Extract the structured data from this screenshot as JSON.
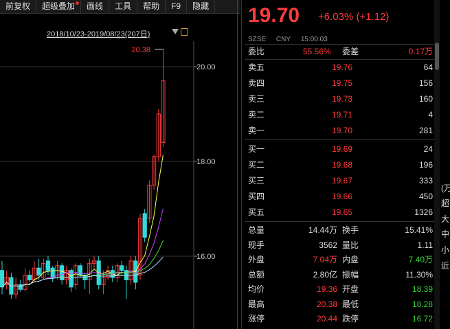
{
  "toolbar": {
    "items": [
      "前复权",
      "超级叠加",
      "画线",
      "工具",
      "帮助",
      "F9",
      "隐藏"
    ]
  },
  "chart": {
    "range": "2018/10/23-2019/08/23(207日)",
    "y_ticks": [
      "20.00",
      "18.00",
      "16.00"
    ],
    "high_marker": "20.38",
    "candles": [
      {
        "o": 15.7,
        "c": 15.35,
        "h": 15.9,
        "l": 15.2
      },
      {
        "o": 15.4,
        "c": 15.55,
        "h": 15.7,
        "l": 15.3
      },
      {
        "o": 15.55,
        "c": 15.2,
        "h": 15.65,
        "l": 15.1
      },
      {
        "o": 15.2,
        "c": 15.4,
        "h": 15.55,
        "l": 15.1
      },
      {
        "o": 15.4,
        "c": 15.3,
        "h": 15.5,
        "l": 15.25
      },
      {
        "o": 15.3,
        "c": 15.6,
        "h": 15.75,
        "l": 15.25
      },
      {
        "o": 15.6,
        "c": 15.5,
        "h": 15.7,
        "l": 15.45
      },
      {
        "o": 15.5,
        "c": 15.75,
        "h": 15.9,
        "l": 15.45
      },
      {
        "o": 15.75,
        "c": 15.6,
        "h": 15.95,
        "l": 15.5
      },
      {
        "o": 15.55,
        "c": 15.85,
        "h": 15.95,
        "l": 15.5
      },
      {
        "o": 15.9,
        "c": 15.7,
        "h": 16.0,
        "l": 15.6
      },
      {
        "o": 15.75,
        "c": 15.55,
        "h": 15.8,
        "l": 15.45
      },
      {
        "o": 15.55,
        "c": 15.8,
        "h": 15.9,
        "l": 15.5
      },
      {
        "o": 15.8,
        "c": 15.5,
        "h": 15.85,
        "l": 15.4
      },
      {
        "o": 15.5,
        "c": 15.7,
        "h": 15.8,
        "l": 15.4
      },
      {
        "o": 15.7,
        "c": 15.35,
        "h": 15.75,
        "l": 15.25
      },
      {
        "o": 15.4,
        "c": 15.8,
        "h": 15.85,
        "l": 15.3
      },
      {
        "o": 15.8,
        "c": 15.6,
        "h": 15.85,
        "l": 15.55
      },
      {
        "o": 15.6,
        "c": 15.5,
        "h": 15.65,
        "l": 15.3
      },
      {
        "o": 15.5,
        "c": 15.85,
        "h": 15.95,
        "l": 15.2
      },
      {
        "o": 15.85,
        "c": 15.9,
        "h": 16.0,
        "l": 15.75
      },
      {
        "o": 15.9,
        "c": 15.4,
        "h": 16.0,
        "l": 15.3
      },
      {
        "o": 15.4,
        "c": 15.55,
        "h": 15.7,
        "l": 15.2
      },
      {
        "o": 15.55,
        "c": 15.7,
        "h": 15.8,
        "l": 15.5
      },
      {
        "o": 15.7,
        "c": 15.55,
        "h": 15.8,
        "l": 15.45
      },
      {
        "o": 15.55,
        "c": 15.8,
        "h": 15.85,
        "l": 15.45
      },
      {
        "o": 15.8,
        "c": 15.7,
        "h": 15.9,
        "l": 15.6
      },
      {
        "o": 15.7,
        "c": 15.5,
        "h": 15.8,
        "l": 15.1
      },
      {
        "o": 15.5,
        "c": 15.9,
        "h": 16.0,
        "l": 15.4
      },
      {
        "o": 15.9,
        "c": 15.45,
        "h": 16.0,
        "l": 15.3
      },
      {
        "o": 15.6,
        "c": 16.8,
        "h": 16.9,
        "l": 15.5
      },
      {
        "o": 16.9,
        "c": 16.4,
        "h": 17.0,
        "l": 16.3
      },
      {
        "o": 16.8,
        "c": 17.5,
        "h": 17.6,
        "l": 16.7
      },
      {
        "o": 17.5,
        "c": 18.1,
        "h": 18.15,
        "l": 17.4
      },
      {
        "o": 18.1,
        "c": 19.0,
        "h": 19.1,
        "l": 18.0
      },
      {
        "o": 18.4,
        "c": 19.7,
        "h": 20.38,
        "l": 18.3
      }
    ],
    "colors": {
      "up": "#ff3b3b",
      "down": "#33d9d9",
      "ma5": "#ffff55",
      "ma10": "#cc44ff",
      "ma20": "#44dd44",
      "ma60": "#aaddff"
    }
  },
  "quote": {
    "price": "19.70",
    "change": "+6.03% (+1.12)",
    "exchange": "SZSE",
    "currency": "CNY",
    "time": "15:00:03",
    "webi_label": "委比",
    "webi_value": "55.56%",
    "weicha_label": "委差",
    "weicha_value": "0.17万",
    "asks": [
      {
        "label": "卖五",
        "price": "19.76",
        "vol": "64"
      },
      {
        "label": "卖四",
        "price": "19.75",
        "vol": "156"
      },
      {
        "label": "卖三",
        "price": "19.73",
        "vol": "160"
      },
      {
        "label": "卖二",
        "price": "19.71",
        "vol": "4"
      },
      {
        "label": "卖一",
        "price": "19.70",
        "vol": "281"
      }
    ],
    "bids": [
      {
        "label": "买一",
        "price": "19.69",
        "vol": "24"
      },
      {
        "label": "买二",
        "price": "19.68",
        "vol": "196"
      },
      {
        "label": "买三",
        "price": "19.67",
        "vol": "333"
      },
      {
        "label": "买四",
        "price": "19.66",
        "vol": "450"
      },
      {
        "label": "买五",
        "price": "19.65",
        "vol": "1326"
      }
    ],
    "stats": [
      {
        "l1": "总量",
        "v1": "14.44万",
        "c1": "white",
        "l2": "换手",
        "v2": "15.41%",
        "c2": "white"
      },
      {
        "l1": "现手",
        "v1": "3562",
        "c1": "white",
        "l2": "量比",
        "v2": "1.11",
        "c2": "white"
      },
      {
        "l1": "外盘",
        "v1": "7.04万",
        "c1": "red",
        "l2": "内盘",
        "v2": "7.40万",
        "c2": "green"
      },
      {
        "l1": "总额",
        "v1": "2.80亿",
        "c1": "white",
        "l2": "振幅",
        "v2": "11.30%",
        "c2": "white"
      },
      {
        "l1": "均价",
        "v1": "19.36",
        "c1": "red",
        "l2": "开盘",
        "v2": "18.39",
        "c2": "green"
      },
      {
        "l1": "最高",
        "v1": "20.38",
        "c1": "red",
        "l2": "最低",
        "v2": "18.28",
        "c2": "green"
      },
      {
        "l1": "涨停",
        "v1": "20.44",
        "c1": "red",
        "l2": "跌停",
        "v2": "16.72",
        "c2": "green"
      }
    ]
  },
  "right_edge": [
    "(万",
    "超",
    "大",
    "中",
    "小",
    "近"
  ]
}
